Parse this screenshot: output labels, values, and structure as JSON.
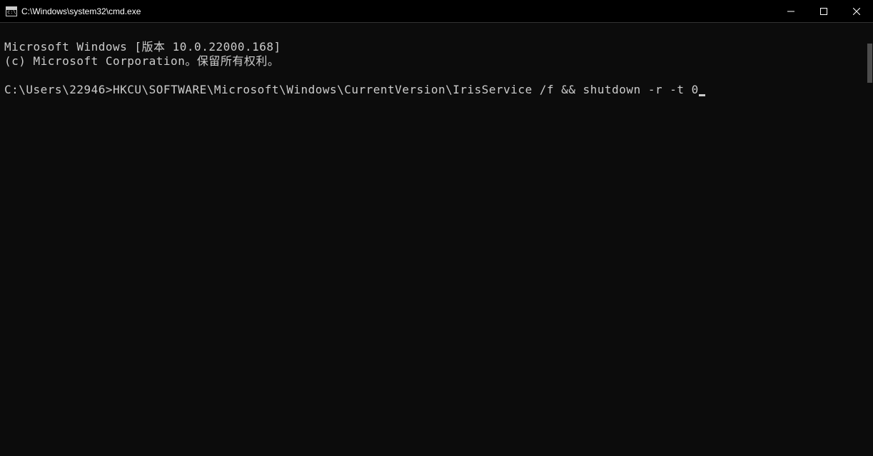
{
  "window": {
    "title": "C:\\Windows\\system32\\cmd.exe"
  },
  "terminal": {
    "line1": "Microsoft Windows [版本 10.0.22000.168]",
    "line2": "(c) Microsoft Corporation。保留所有权利。",
    "prompt": "C:\\Users\\22946>",
    "command": "HKCU\\SOFTWARE\\Microsoft\\Windows\\CurrentVersion\\IrisService /f && shutdown -r -t 0"
  }
}
